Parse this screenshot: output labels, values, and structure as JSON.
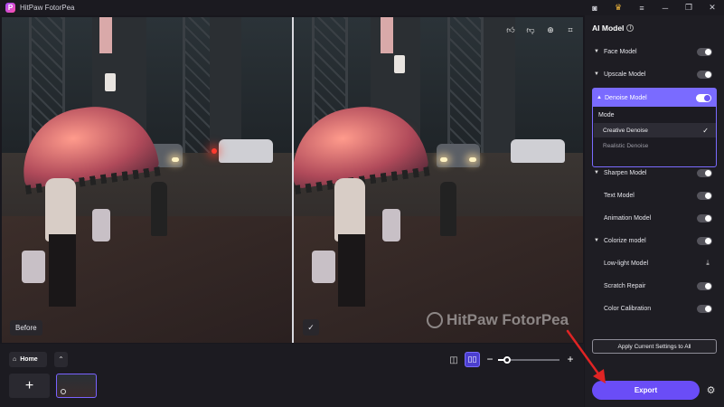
{
  "app": {
    "title": "HitPaw FotorPea",
    "logo_letter": "P"
  },
  "titlebar_icons": [
    "discord-icon",
    "crown-icon",
    "menu-icon",
    "minimize-icon",
    "maximize-icon",
    "close-icon"
  ],
  "preview": {
    "before_label": "Before",
    "check_badge": "✓",
    "watermark": "HitPaw FotorPea",
    "tools": [
      "thumbs-up-icon",
      "thumbs-down-icon",
      "zoom-icon",
      "crop-icon"
    ]
  },
  "bottom": {
    "home_label": "Home",
    "add_label": "+",
    "zoom_minus": "−",
    "zoom_plus": "+",
    "zoom_fraction": 0.15
  },
  "panel": {
    "title": "AI Model",
    "info": "i",
    "models": [
      {
        "label": "Face Model",
        "caret": "▼",
        "toggle": "off"
      },
      {
        "label": "Upscale Model",
        "caret": "▼",
        "toggle": "off"
      },
      {
        "label": "Denoise Model",
        "caret": "▲",
        "toggle": "on"
      },
      {
        "label": "Sharpen Model",
        "caret": "▼",
        "toggle": "off"
      },
      {
        "label": "Text Model",
        "caret": "",
        "toggle": "off"
      },
      {
        "label": "Animation Model",
        "caret": "",
        "toggle": "off"
      },
      {
        "label": "Colorize model",
        "caret": "▼",
        "toggle": "off"
      },
      {
        "label": "Low-light Model",
        "caret": "",
        "toggle": "download"
      },
      {
        "label": "Scratch Repair",
        "caret": "",
        "toggle": "off"
      },
      {
        "label": "Color Calibration",
        "caret": "",
        "toggle": "off"
      }
    ],
    "denoise": {
      "mode_label": "Mode",
      "options": [
        "Creative Denoise",
        "Realistic Denoise"
      ],
      "selected": "Creative Denoise"
    },
    "apply_label": "Apply Current Settings to All",
    "export_label": "Export"
  },
  "colors": {
    "accent": "#6a4df7",
    "accent_light": "#7a6bff",
    "panel_bg": "#1e1d23",
    "arrow": "#e02424"
  }
}
